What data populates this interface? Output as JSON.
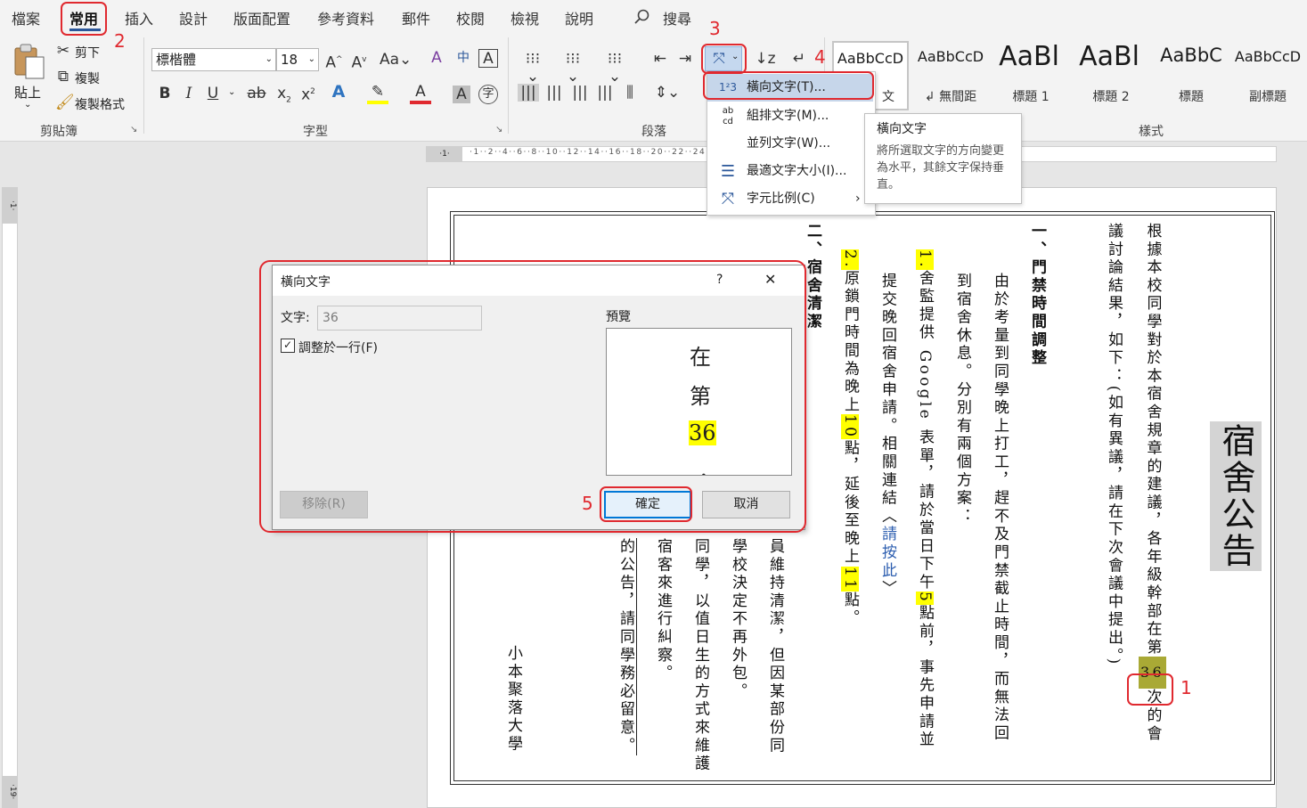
{
  "tabs": [
    "檔案",
    "常用",
    "插入",
    "設計",
    "版面配置",
    "參考資料",
    "郵件",
    "校閱",
    "檢視",
    "說明"
  ],
  "search_label": "搜尋",
  "clipboard": {
    "paste": "貼上",
    "cut": "剪下",
    "copy": "複製",
    "format_painter": "複製格式",
    "group": "剪貼簿"
  },
  "font": {
    "name": "標楷體",
    "size": "18",
    "group": "字型"
  },
  "paragraph": {
    "group": "段落"
  },
  "styles": {
    "group": "樣式",
    "items": [
      {
        "sample": "AaBbCcD",
        "name": "文"
      },
      {
        "sample": "AaBbCcD",
        "name": "↲ 無間距"
      },
      {
        "sample": "AaBl",
        "name": "標題 1"
      },
      {
        "sample": "AaBl",
        "name": "標題 2"
      },
      {
        "sample": "AaBbC",
        "name": "標題"
      },
      {
        "sample": "AaBbCcD",
        "name": "副標題"
      }
    ]
  },
  "hruler_left": "·1·",
  "hruler_ticks": "·1··2··4··6··8··10··12··14··16··18··20··22··24··26··28",
  "vruler_marks": "·1·",
  "vruler_bottom": "·19·",
  "menu": {
    "items": [
      {
        "icon": "1²3",
        "label": "橫向文字(T)..."
      },
      {
        "icon": "ab cd",
        "label": "組排文字(M)..."
      },
      {
        "icon": "",
        "label": "並列文字(W)..."
      },
      {
        "icon": "☰",
        "label": "最適文字大小(I)..."
      },
      {
        "icon": "⤧",
        "label": "字元比例(C)"
      }
    ]
  },
  "tooltip": {
    "title": "橫向文字",
    "body": "將所選取文字的方向變更為水平，其餘文字保持垂直。"
  },
  "dialog": {
    "title": "橫向文字",
    "help": "?",
    "close": "✕",
    "text_label": "文字:",
    "text_value": "36",
    "fit_label": "調整於一行(F)",
    "preview_label": "預覽",
    "preview_chars": [
      "在",
      "第",
      "36",
      "，"
    ],
    "remove": "移除(R)",
    "ok": "確定",
    "cancel": "取消"
  },
  "annotations": [
    "1",
    "2",
    "3",
    "4",
    "5"
  ],
  "document": {
    "title": "宿舍公告",
    "col1a": "根據本校同學對於本宿舍規章的建議，各年級幹部在第",
    "col1_num": "36",
    "col1b": "次的會",
    "col2": "議討論結果，如下：(如有異議，請在下次會議中提出。)",
    "sec1": "一、門禁時間調整",
    "col4": "由於考量到同學晚上打工，趕不及門禁截止時間，而無法回",
    "col5": "到宿舍休息。分別有兩個方案：",
    "item1_num": "1.",
    "item1a": "舍監提供 Google 表單，請於當日下午",
    "item1_hl": "5",
    "item1b": "點前，事先申請並",
    "col7a": "提交晚回宿舍申請。相關連結〈",
    "col7_link": "請按此",
    "col7b": "〉",
    "item2_num": "2.",
    "item2a": "原鎖門時間為晚上",
    "item2_hl1": "10",
    "item2b": "點，延後至晚上",
    "item2_hl2": "11",
    "item2c": "點。",
    "sec2": "二、宿舍清潔",
    "c9": "員維持清潔，但因某部份同",
    "c10": "學校決定不再外包。",
    "c11": "同學，以值日生的方式來維護",
    "c12": "宿客來進行糾察。",
    "c13": "的公告，請同學務必留意。",
    "signature": "小本聚落大學"
  }
}
